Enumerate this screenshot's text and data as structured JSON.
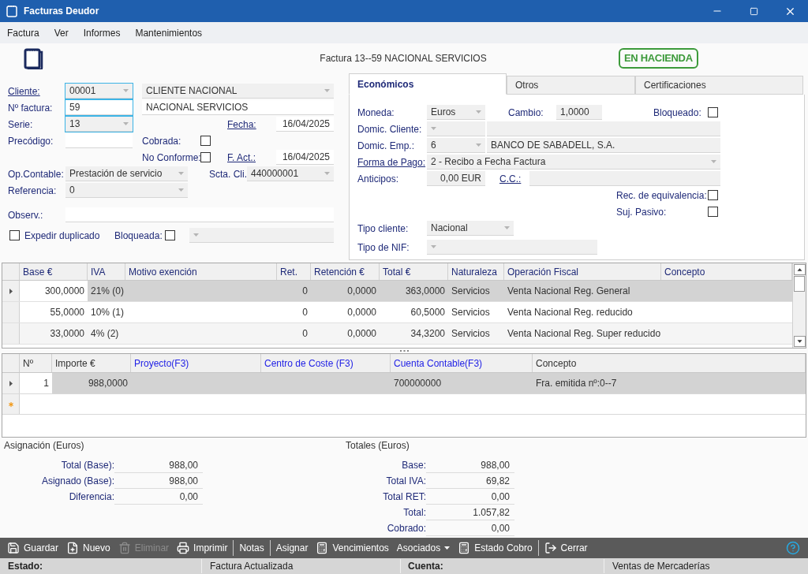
{
  "window": {
    "title": "Facturas Deudor"
  },
  "menu": [
    "Factura",
    "Ver",
    "Informes",
    "Mantenimientos"
  ],
  "header": {
    "caption": "Factura 13--59 NACIONAL SERVICIOS",
    "stamp": "EN HACIENDA"
  },
  "invoice": {
    "cliente": {
      "label": "Cliente:",
      "link": true,
      "code": "00001",
      "name": "CLIENTE NACIONAL"
    },
    "numero": {
      "label": "Nº factura:",
      "link": false,
      "value": "59",
      "name": "NACIONAL SERVICIOS"
    },
    "serie": {
      "label": "Serie:",
      "link": false,
      "value": "13"
    },
    "fecha": {
      "label": "Fecha:",
      "link": true,
      "value": "16/04/2025"
    },
    "precodigo": {
      "label": "Precódigo:",
      "link": false
    },
    "cobrada": {
      "label": "Cobrada:",
      "link": false,
      "checked": false
    },
    "no_conforme": {
      "label": "No Conforme:",
      "link": false,
      "checked": false
    },
    "f_act": {
      "label": "F. Act.:",
      "link": true,
      "value": "16/04/2025"
    },
    "op_contable": {
      "label": "Op.Contable:",
      "link": false,
      "value": "Prestación de servicio"
    },
    "scta_cli": {
      "label": "Scta. Cli.",
      "link": false,
      "value": "440000001"
    },
    "referencia": {
      "label": "Referencia:",
      "link": false,
      "value": "0"
    },
    "observ": {
      "label": "Observ.:",
      "link": false
    },
    "expedir": {
      "label": "Expedir duplicado",
      "link": false,
      "checked": false
    },
    "bloqueada": {
      "label": "Bloqueada:",
      "link": false,
      "checked": false
    }
  },
  "tabs": [
    {
      "label": "Económicos",
      "selected": true
    },
    {
      "label": "Otros",
      "selected": false
    },
    {
      "label": "Certificaciones",
      "selected": false
    }
  ],
  "economicos": {
    "moneda": {
      "label": "Moneda:",
      "link": false,
      "value": "Euros"
    },
    "cambio": {
      "label": "Cambio:",
      "link": false,
      "value": "1,0000"
    },
    "bloqueado": {
      "label": "Bloqueado:",
      "link": false,
      "checked": false
    },
    "domic_cliente": {
      "label": "Domic. Cliente:",
      "link": false
    },
    "domic_emp": {
      "label": "Domic. Emp.:",
      "link": false,
      "value": "6",
      "name": "BANCO DE SABADELL, S.A."
    },
    "forma_pago": {
      "label": "Forma de Pago:",
      "link": true,
      "value": "2 - Recibo a Fecha Factura"
    },
    "anticipos": {
      "label": "Anticipos:",
      "link": false,
      "value": "0,00 EUR"
    },
    "cc": {
      "label": "C.C.:",
      "link": true
    },
    "rec_equiv": {
      "label": "Rec. de equivalencia:",
      "link": false,
      "checked": false
    },
    "suj_pasivo": {
      "label": "Suj. Pasivo:",
      "link": false,
      "checked": false
    },
    "tipo_cliente": {
      "label": "Tipo cliente:",
      "link": false,
      "value": "Nacional"
    },
    "tipo_nif": {
      "label": "Tipo de NIF:",
      "link": false
    }
  },
  "tax_table": {
    "columns": [
      "Base €",
      "IVA",
      "Motivo exención",
      "Ret.",
      "Retención €",
      "Total €",
      "Naturaleza",
      "Operación Fiscal",
      "Concepto"
    ],
    "rows": [
      {
        "selected": true,
        "base": "300,0000",
        "iva": "21% (0)",
        "ret": "0",
        "retencion": "0,0000",
        "total": "363,0000",
        "naturaleza": "Servicios",
        "operacion": "Venta Nacional Reg. General"
      },
      {
        "selected": false,
        "base": "55,0000",
        "iva": "10% (1)",
        "ret": "0",
        "retencion": "0,0000",
        "total": "60,5000",
        "naturaleza": "Servicios",
        "operacion": "Venta Nacional Reg. reducido"
      },
      {
        "selected": false,
        "base": "33,0000",
        "iva": "4% (2)",
        "ret": "0",
        "retencion": "0,0000",
        "total": "34,3200",
        "naturaleza": "Servicios",
        "operacion": "Venta Nacional Reg. Super reducido"
      }
    ]
  },
  "alloc_table": {
    "columns": [
      {
        "label": "Nº",
        "kind": "plain"
      },
      {
        "label": "Importe €",
        "kind": "plain"
      },
      {
        "label": "Proyecto(F3)",
        "kind": "lookup"
      },
      {
        "label": "Centro de Coste (F3)",
        "kind": "lookup"
      },
      {
        "label": "Cuenta Contable(F3)",
        "kind": "lookup"
      },
      {
        "label": "Concepto",
        "kind": "plain"
      }
    ],
    "rows": [
      {
        "selected": true,
        "n": "1",
        "importe": "988,0000",
        "cuenta": "700000000",
        "concepto": "Fra. emitida nº:0--7"
      }
    ]
  },
  "asignacion": {
    "title": "Asignación (Euros)",
    "rows": [
      {
        "label": "Total (Base):",
        "value": "988,00"
      },
      {
        "label": "Asignado (Base):",
        "value": "988,00"
      },
      {
        "label": "Diferencia:",
        "value": "0,00"
      }
    ]
  },
  "totales": {
    "title": "Totales (Euros)",
    "rows": [
      {
        "label": "Base:",
        "value": "988,00"
      },
      {
        "label": "Total IVA:",
        "value": "69,82"
      },
      {
        "label": "Total RET:",
        "value": "0,00"
      },
      {
        "label": "Total:",
        "value": "1.057,82"
      },
      {
        "label": "Cobrado:",
        "value": "0,00"
      }
    ]
  },
  "toolbar": {
    "groups": [
      [
        {
          "label": "Guardar",
          "kind": "button",
          "disabled": false
        },
        {
          "label": "Nuevo",
          "kind": "button",
          "disabled": false
        },
        {
          "label": "Eliminar",
          "kind": "button",
          "disabled": true
        },
        {
          "label": "Imprimir",
          "kind": "button",
          "disabled": false
        }
      ],
      [
        {
          "label": "Notas",
          "kind": "button",
          "disabled": false
        }
      ],
      [
        {
          "label": "Asignar",
          "kind": "button",
          "disabled": false
        },
        {
          "label": "Vencimientos",
          "kind": "button",
          "disabled": false
        },
        {
          "label": "Asociados",
          "kind": "menu",
          "disabled": false
        },
        {
          "label": "Estado Cobro",
          "kind": "button",
          "disabled": false
        }
      ],
      [
        {
          "label": "Cerrar",
          "kind": "button",
          "disabled": false
        }
      ]
    ]
  },
  "status_bar": {
    "estado_label": "Estado:",
    "estado": "Factura Actualizada",
    "cuenta_label": "Cuenta:",
    "cuenta": "Ventas de Mercaderías"
  }
}
